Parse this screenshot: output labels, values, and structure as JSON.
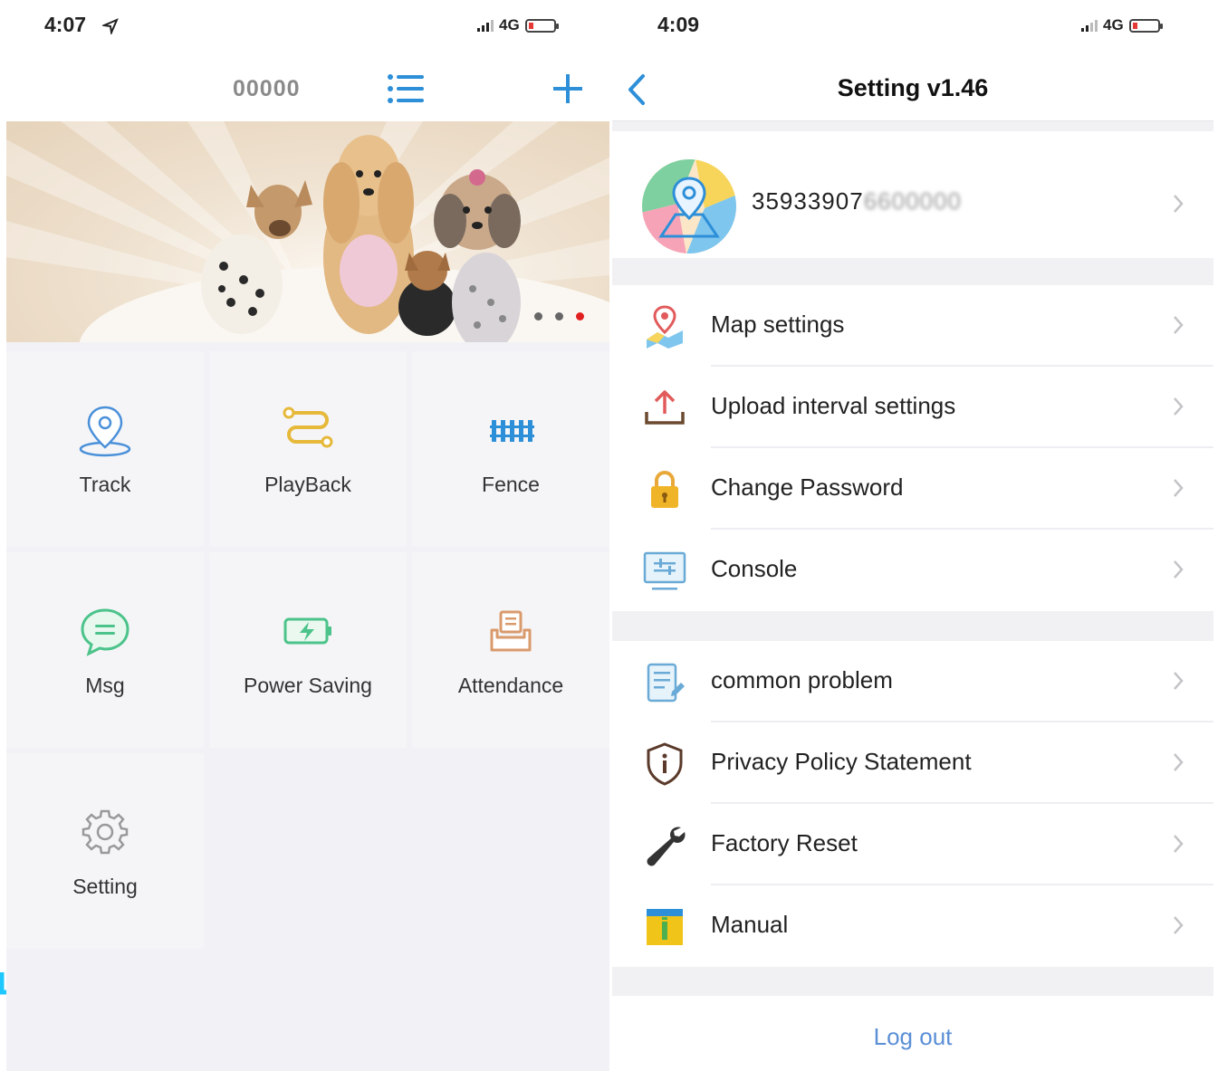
{
  "left": {
    "status": {
      "time": "4:07",
      "network": "4G"
    },
    "navbar": {
      "title": "00000"
    },
    "banner": {
      "dots": 3,
      "active_dot": 3
    },
    "grid": [
      {
        "label": "Track",
        "icon": "location-pin-icon"
      },
      {
        "label": "PlayBack",
        "icon": "route-icon"
      },
      {
        "label": "Fence",
        "icon": "fence-icon"
      },
      {
        "label": "Msg",
        "icon": "chat-bubble-icon"
      },
      {
        "label": "Power Saving",
        "icon": "battery-bolt-icon"
      },
      {
        "label": "Attendance",
        "icon": "printer-icon"
      },
      {
        "label": "Setting",
        "icon": "gear-icon"
      }
    ]
  },
  "right": {
    "status": {
      "time": "4:09",
      "network": "4G"
    },
    "navbar": {
      "title": "Setting v1.46"
    },
    "profile": {
      "imei_visible": "35933907",
      "imei_blurred": "6600000"
    },
    "group1": [
      {
        "label": "Map settings",
        "icon": "map-settings-icon"
      },
      {
        "label": "Upload interval settings",
        "icon": "upload-icon"
      },
      {
        "label": "Change Password",
        "icon": "lock-icon"
      },
      {
        "label": "Console",
        "icon": "console-icon"
      }
    ],
    "group2": [
      {
        "label": "common problem",
        "icon": "document-icon"
      },
      {
        "label": "Privacy Policy Statement",
        "icon": "shield-info-icon"
      },
      {
        "label": "Factory Reset",
        "icon": "wrench-icon"
      },
      {
        "label": "Manual",
        "icon": "manual-icon"
      }
    ],
    "logout": {
      "label": "Log out"
    }
  },
  "colors": {
    "accent_blue": "#2d8fd8",
    "yellow": "#f0b429",
    "green": "#4cc38a",
    "red_dot": "#e02020",
    "logout_blue": "#5b8fd6"
  }
}
